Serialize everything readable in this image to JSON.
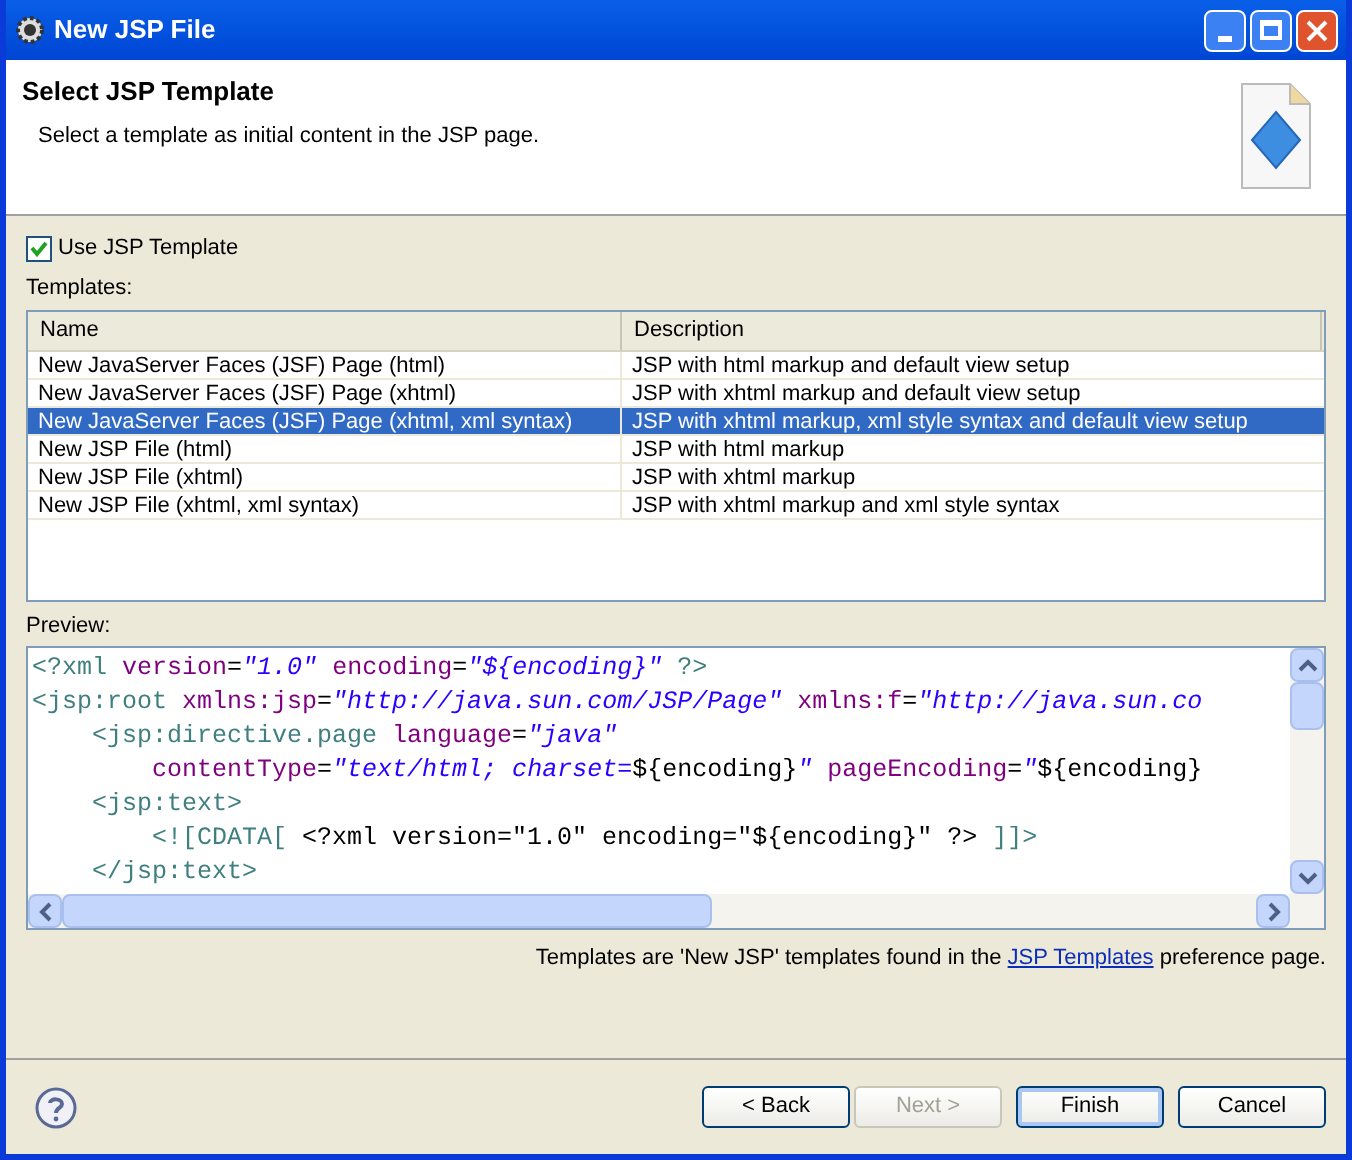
{
  "window": {
    "title": "New JSP File"
  },
  "header": {
    "title": "Select JSP Template",
    "description": "Select a template as initial content in the JSP page."
  },
  "use_template": {
    "label": "Use JSP Template",
    "checked": true
  },
  "templates": {
    "label": "Templates:",
    "columns": [
      "Name",
      "Description"
    ],
    "rows": [
      {
        "name": "New JavaServer Faces (JSF) Page (html)",
        "description": "JSP with html markup and default view setup",
        "selected": false
      },
      {
        "name": "New JavaServer Faces (JSF) Page (xhtml)",
        "description": "JSP with xhtml markup and default view setup",
        "selected": false
      },
      {
        "name": "New JavaServer Faces (JSF) Page (xhtml, xml syntax)",
        "description": "JSP with xhtml markup, xml style syntax and default view setup",
        "selected": true
      },
      {
        "name": "New JSP File (html)",
        "description": "JSP with html markup",
        "selected": false
      },
      {
        "name": "New JSP File (xhtml)",
        "description": "JSP with xhtml markup",
        "selected": false
      },
      {
        "name": "New JSP File (xhtml, xml syntax)",
        "description": "JSP with xhtml markup and xml style syntax",
        "selected": false
      }
    ]
  },
  "preview": {
    "label": "Preview:",
    "lines": [
      [
        {
          "kind": "tag",
          "text": "<?xml"
        },
        {
          "kind": "attr",
          "text": " version"
        },
        {
          "kind": "plain",
          "text": "="
        },
        {
          "kind": "string",
          "text": "\"1.0\""
        },
        {
          "kind": "attr",
          "text": " encoding"
        },
        {
          "kind": "plain",
          "text": "="
        },
        {
          "kind": "string",
          "text": "\"${encoding}\""
        },
        {
          "kind": "tag",
          "text": " ?>"
        }
      ],
      [
        {
          "kind": "tag",
          "text": "<jsp:root"
        },
        {
          "kind": "attr",
          "text": " xmlns:jsp"
        },
        {
          "kind": "plain",
          "text": "="
        },
        {
          "kind": "string",
          "text": "\"http://java.sun.com/JSP/Page\""
        },
        {
          "kind": "attr",
          "text": " xmlns:f"
        },
        {
          "kind": "plain",
          "text": "="
        },
        {
          "kind": "string",
          "text": "\"http://java.sun.co"
        }
      ],
      [
        {
          "kind": "tag",
          "text": "    <jsp:directive.page"
        },
        {
          "kind": "attr",
          "text": " language"
        },
        {
          "kind": "plain",
          "text": "="
        },
        {
          "kind": "string",
          "text": "\"java\""
        }
      ],
      [
        {
          "kind": "attr",
          "text": "        contentType"
        },
        {
          "kind": "plain",
          "text": "="
        },
        {
          "kind": "string",
          "text": "\"text/html; charset="
        },
        {
          "kind": "plain",
          "text": "${encoding}"
        },
        {
          "kind": "string",
          "text": "\""
        },
        {
          "kind": "attr",
          "text": " pageEncoding"
        },
        {
          "kind": "plain",
          "text": "="
        },
        {
          "kind": "string",
          "text": "\""
        },
        {
          "kind": "plain",
          "text": "${encoding}"
        }
      ],
      [
        {
          "kind": "tag",
          "text": "    <jsp:text>"
        }
      ],
      [
        {
          "kind": "tag",
          "text": "        <![CDATA["
        },
        {
          "kind": "plain",
          "text": " <?xml version=\"1.0\" encoding=\"${encoding}\" ?> "
        },
        {
          "kind": "tag",
          "text": "]]>"
        }
      ],
      [
        {
          "kind": "tag",
          "text": "    </jsp:text>"
        }
      ]
    ]
  },
  "footer_note": {
    "before": "Templates are 'New JSP' templates found in the ",
    "link": "JSP Templates",
    "after": " preference page."
  },
  "buttons": [
    {
      "label": "< Back",
      "disabled": false,
      "default": false
    },
    {
      "label": "Next >",
      "disabled": true,
      "default": false
    },
    {
      "label": "Finish",
      "disabled": false,
      "default": true
    },
    {
      "label": "Cancel",
      "disabled": false,
      "default": false
    }
  ]
}
